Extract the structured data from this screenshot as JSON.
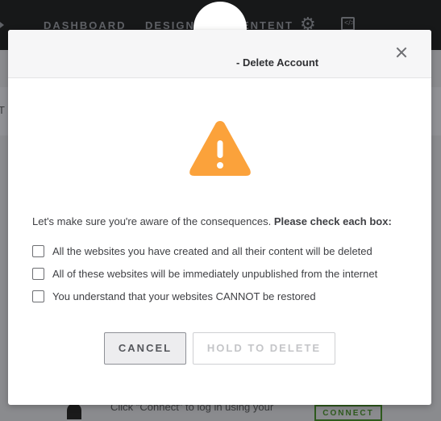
{
  "background": {
    "nav": {
      "dashboard": "DASHBOARD",
      "design": "DESIGN",
      "content": "ENTENT"
    },
    "tab_fragment": "T",
    "connect_text": "Click \"Connect\" to log in using your",
    "connect_button": "CONNECT"
  },
  "modal": {
    "title": "- Delete Account",
    "prompt": "Let's make sure you're aware of the consequences. ",
    "prompt_bold": "Please check each box:",
    "checks": [
      {
        "label": "All the websites you have created and all their content will be deleted",
        "checked": false
      },
      {
        "label": "All of these websites will be immediately unpublished from the internet",
        "checked": false
      },
      {
        "label": "You understand that your websites CANNOT be restored",
        "checked": false
      }
    ],
    "cancel_label": "CANCEL",
    "delete_label": "HOLD TO DELETE",
    "warning_icon_color": "#FBA23B"
  }
}
